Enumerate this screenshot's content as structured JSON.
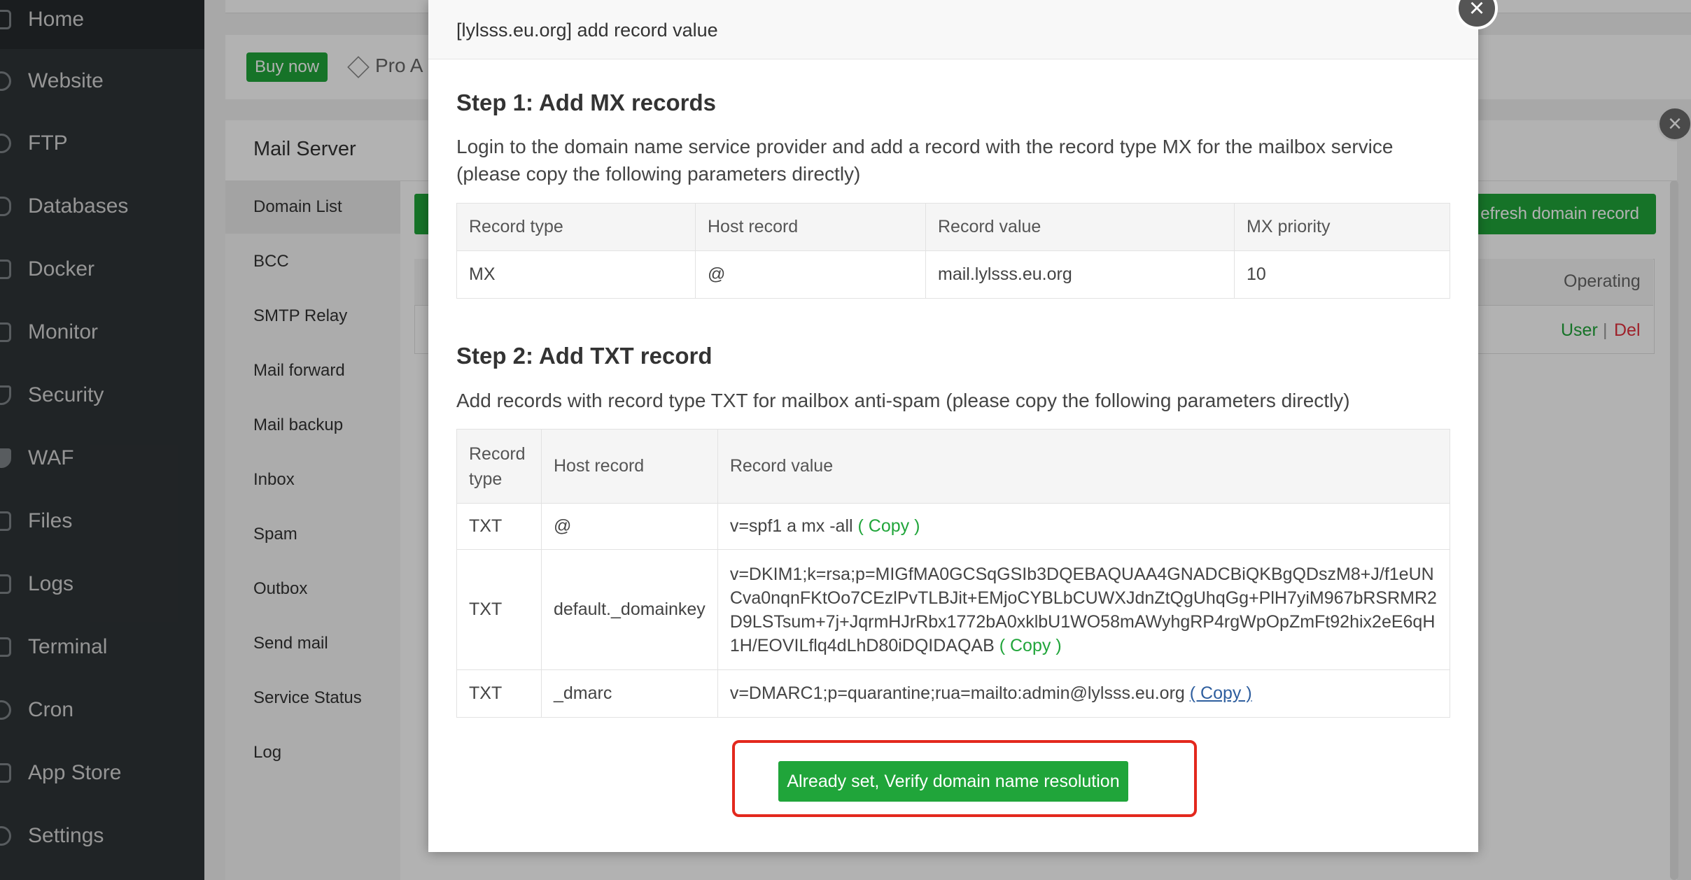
{
  "sidebar": {
    "items": [
      {
        "label": "Home",
        "icon": "home-icon"
      },
      {
        "label": "Website",
        "icon": "globe-icon"
      },
      {
        "label": "FTP",
        "icon": "ftp-icon"
      },
      {
        "label": "Databases",
        "icon": "database-icon"
      },
      {
        "label": "Docker",
        "icon": "docker-icon"
      },
      {
        "label": "Monitor",
        "icon": "monitor-icon"
      },
      {
        "label": "Security",
        "icon": "shield-icon"
      },
      {
        "label": "WAF",
        "icon": "waf-icon"
      },
      {
        "label": "Files",
        "icon": "folder-icon"
      },
      {
        "label": "Logs",
        "icon": "logs-icon"
      },
      {
        "label": "Terminal",
        "icon": "terminal-icon"
      },
      {
        "label": "Cron",
        "icon": "clock-icon"
      },
      {
        "label": "App Store",
        "icon": "app-store-icon"
      },
      {
        "label": "Settings",
        "icon": "gear-icon"
      }
    ]
  },
  "topbar": {
    "buy_label": "Buy now",
    "pro_label": "Pro A"
  },
  "mail_server": {
    "title": "Mail Server",
    "menu": [
      "Domain List",
      "BCC",
      "SMTP Relay",
      "Mail forward",
      "Mail backup",
      "Inbox",
      "Spam",
      "Outbox",
      "Send mail",
      "Service Status",
      "Log"
    ],
    "refresh_label": "efresh domain record",
    "operating_header": "Operating",
    "user_link": "User",
    "separator": "|",
    "del_link": "Del"
  },
  "dialog": {
    "title": "[lylsss.eu.org] add record value",
    "step1": {
      "title": "Step 1: Add MX records",
      "description": "Login to the domain name service provider and add a record with the record type MX for the mailbox service (please copy the following parameters directly)",
      "headers": [
        "Record type",
        "Host record",
        "Record value",
        "MX priority"
      ],
      "row": [
        "MX",
        "@",
        "mail.lylsss.eu.org",
        "10"
      ]
    },
    "step2": {
      "title": "Step 2: Add TXT record",
      "description": "Add records with record type TXT for mailbox anti-spam (please copy the following parameters directly)",
      "headers": [
        "Record type",
        "Host record",
        "Record value"
      ],
      "rows": [
        {
          "type": "TXT",
          "host": "@",
          "value": "v=spf1 a mx -all",
          "copy": "( Copy )"
        },
        {
          "type": "TXT",
          "host": "default._domainkey",
          "value": "v=DKIM1;k=rsa;p=MIGfMA0GCSqGSIb3DQEBAQUAA4GNADCBiQKBgQDszM8+J/f1eUNCva0nqnFKtOo7CEzlPvTLBJit+EMjoCYBLbCUWXJdnZtQgUhqGg+PlH7yiM967bRSRMR2D9LSTsum+7j+JqrmHJrRbx1772bA0xklbU1WO58mAWyhgRP4rgWpOpZmFt92hix2eE6qH1H/EOVILflq4dLhD80iDQIDAQAB",
          "copy": "( Copy )"
        },
        {
          "type": "TXT",
          "host": "_dmarc",
          "value": "v=DMARC1;p=quarantine;rua=mailto:admin@lylsss.eu.org",
          "copy": "( Copy )"
        }
      ]
    },
    "verify_label": "Already set, Verify domain name resolution"
  },
  "colors": {
    "accent_green": "#20a53a",
    "highlight_red": "#e3281d",
    "delete_red": "#e3303d",
    "sidebar_bg": "#2f3437"
  }
}
